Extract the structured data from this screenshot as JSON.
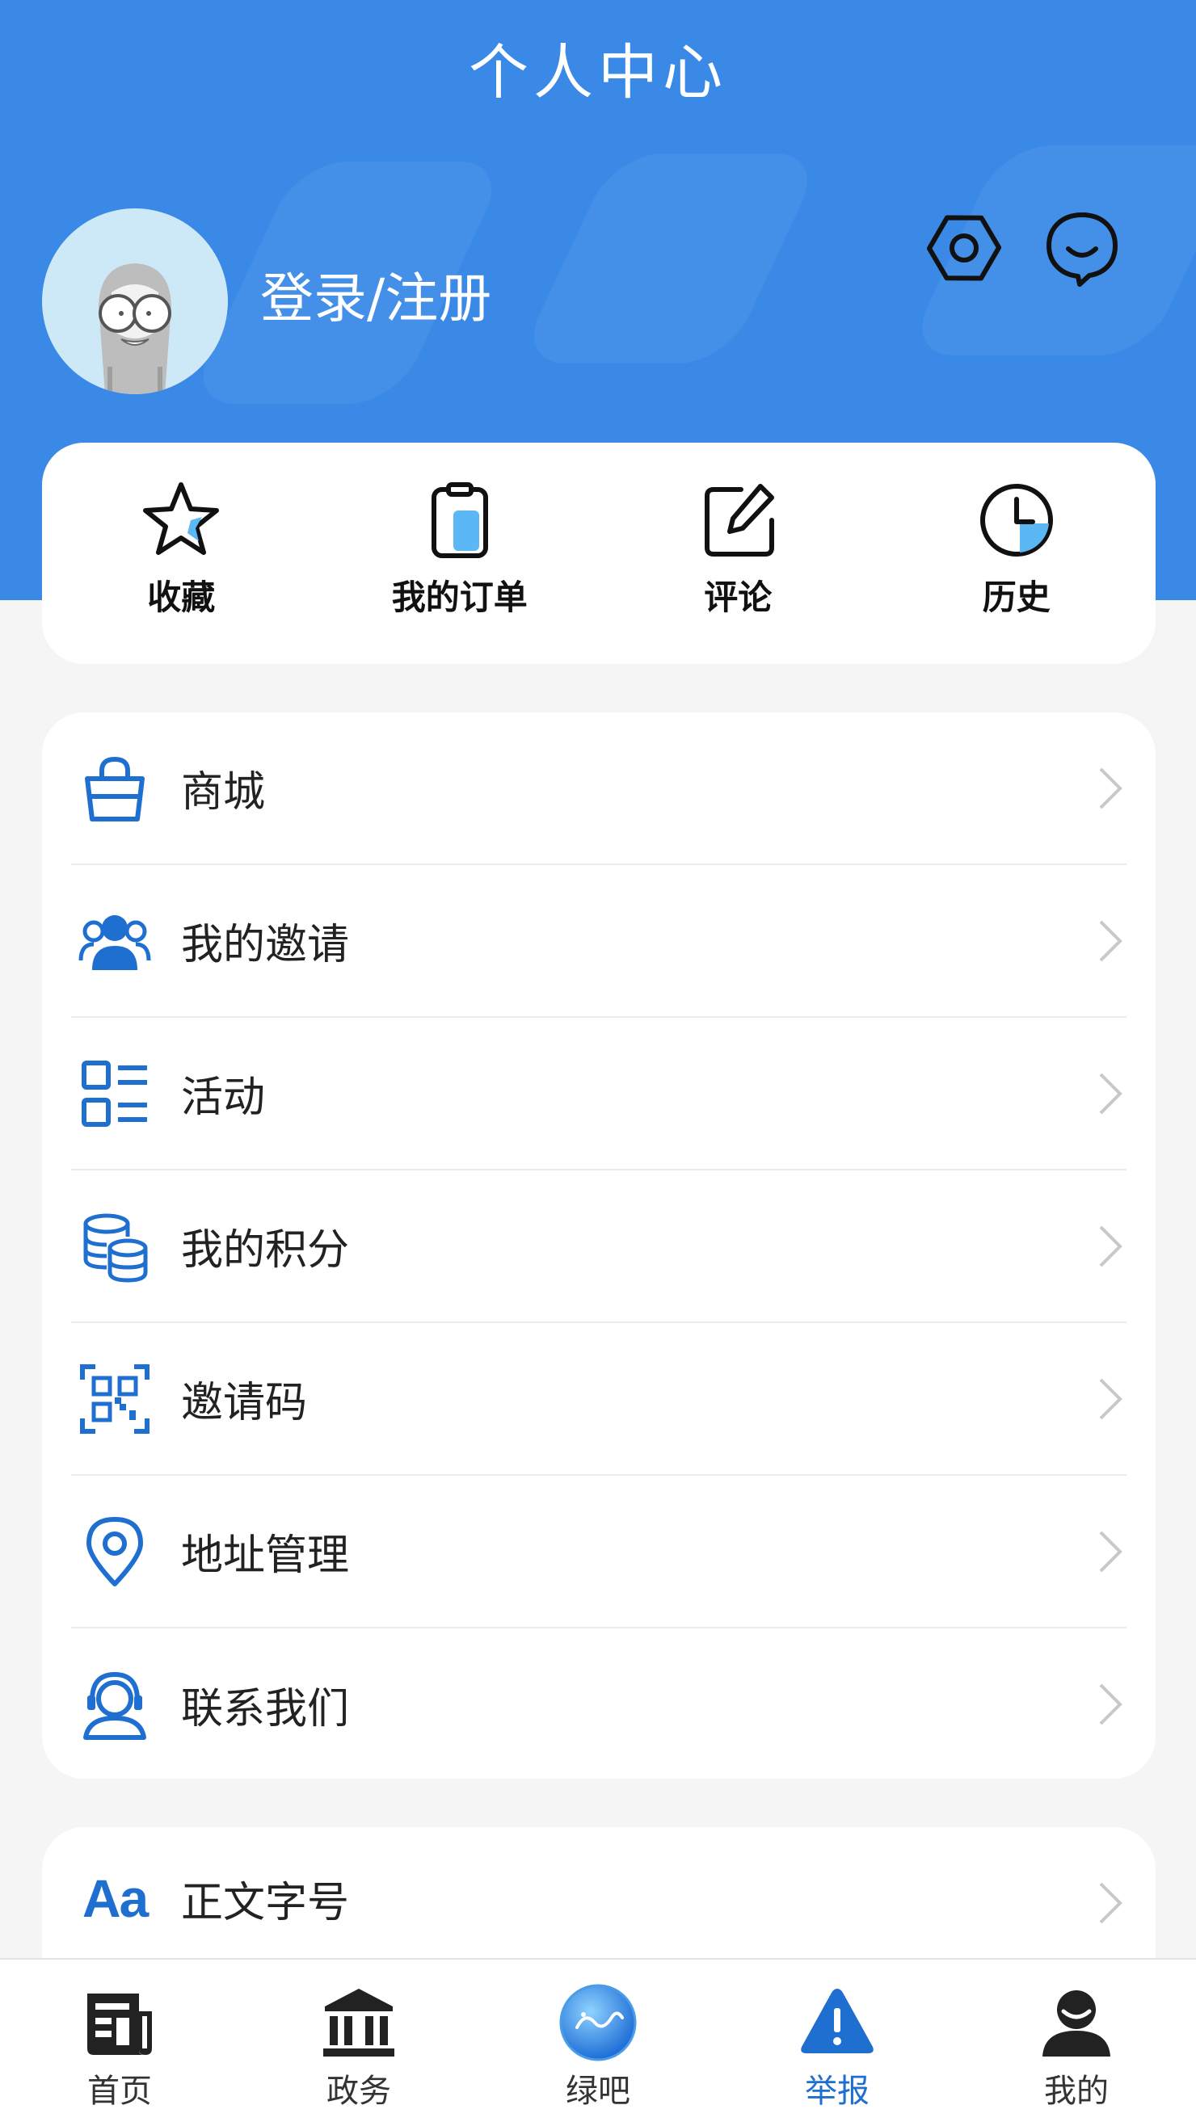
{
  "header": {
    "title": "个人中心",
    "login_label": "登录/注册",
    "settings_icon": "hexagon-settings-icon",
    "message_icon": "chat-bubble-icon"
  },
  "quick_actions": [
    {
      "label": "收藏",
      "icon": "star-icon"
    },
    {
      "label": "我的订单",
      "icon": "clipboard-icon"
    },
    {
      "label": "评论",
      "icon": "edit-icon"
    },
    {
      "label": "历史",
      "icon": "clock-icon"
    }
  ],
  "menu": [
    {
      "label": "商城",
      "icon": "shopping-bag-icon"
    },
    {
      "label": "我的邀请",
      "icon": "users-icon"
    },
    {
      "label": "活动",
      "icon": "list-icon"
    },
    {
      "label": "我的积分",
      "icon": "coins-icon"
    },
    {
      "label": "邀请码",
      "icon": "qr-code-icon"
    },
    {
      "label": "地址管理",
      "icon": "location-icon"
    },
    {
      "label": "联系我们",
      "icon": "customer-service-icon"
    }
  ],
  "font_setting": {
    "label": "正文字号",
    "icon_text": "Aa"
  },
  "tabs": [
    {
      "label": "首页",
      "icon": "newspaper-icon",
      "active": false
    },
    {
      "label": "政务",
      "icon": "government-building-icon",
      "active": false
    },
    {
      "label": "绿吧",
      "icon": "lvba-logo-icon",
      "active": false
    },
    {
      "label": "举报",
      "icon": "warning-icon",
      "active": true
    },
    {
      "label": "我的",
      "icon": "profile-icon",
      "active": false
    }
  ],
  "colors": {
    "primary": "#3a89e6",
    "accent": "#1f6fd0",
    "light_blue": "#5bb8f5"
  }
}
